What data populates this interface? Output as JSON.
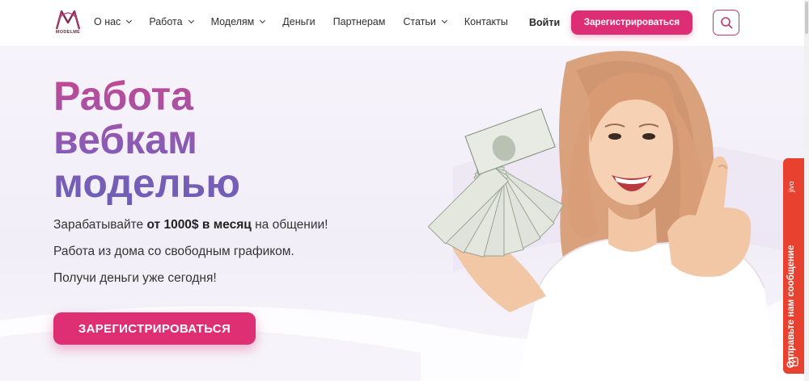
{
  "header": {
    "logo_text": "MODELME",
    "nav": [
      {
        "label": "О нас",
        "has_dropdown": true
      },
      {
        "label": "Работа",
        "has_dropdown": true
      },
      {
        "label": "Моделям",
        "has_dropdown": true
      },
      {
        "label": "Деньги",
        "has_dropdown": false
      },
      {
        "label": "Партнерам",
        "has_dropdown": false
      },
      {
        "label": "Статьи",
        "has_dropdown": true
      },
      {
        "label": "Контакты",
        "has_dropdown": false
      }
    ],
    "login_label": "Войти",
    "register_label": "Зарегистрироваться",
    "search_icon": "search-icon"
  },
  "hero": {
    "headline_line1": "Работа",
    "headline_line2": "вебкам",
    "headline_line3": "моделью",
    "p1_pre": "Зарабатывайте ",
    "p1_bold": "от 1000$ в месяц",
    "p1_post": " на общении!",
    "p2": "Работа из дома со свободным графиком.",
    "p3": "Получи деньги уже сегодня!",
    "cta_label": "ЗАРЕГИСТРИРОВАТЬСЯ"
  },
  "chat_widget": {
    "label": "Отправьте нам сообщение",
    "logo": "jivo"
  },
  "colors": {
    "accent": "#dd2d75",
    "headline_top": "#c44892",
    "headline_bottom": "#6b5fb7",
    "chat": "#e8412f"
  }
}
